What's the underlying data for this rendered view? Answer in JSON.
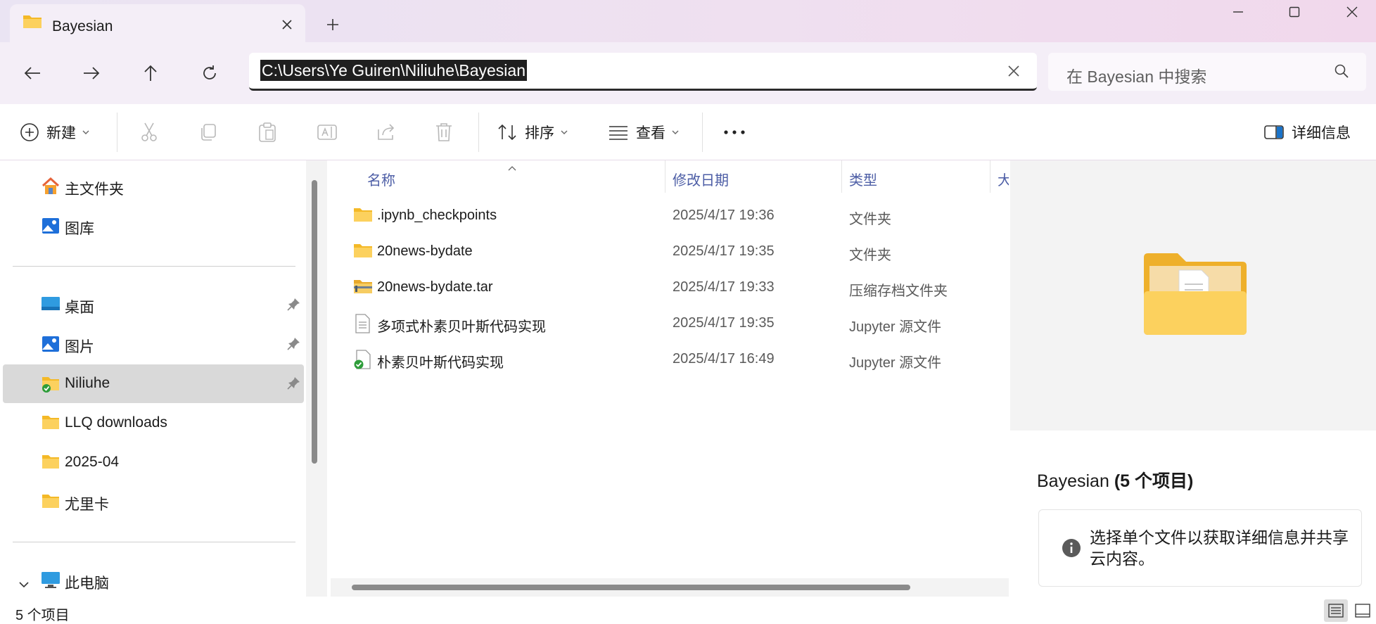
{
  "tab": {
    "title": "Bayesian",
    "new_tab": "+"
  },
  "address": {
    "path": "C:\\Users\\Ye Guiren\\Niliuhe\\Bayesian"
  },
  "search": {
    "placeholder": "在 Bayesian 中搜索"
  },
  "toolbar": {
    "new_label": "新建",
    "sort_label": "排序",
    "view_label": "查看",
    "more_label": "•••",
    "details_label": "详细信息"
  },
  "sidebar": {
    "home": "主文件夹",
    "gallery": "图库",
    "desktop": "桌面",
    "pictures": "图片",
    "niliuhe": "Niliuhe",
    "llq": "LLQ downloads",
    "month": "2025-04",
    "youlika": "尤里卡",
    "this_pc": "此电脑"
  },
  "columns": {
    "name": "名称",
    "modified": "修改日期",
    "type": "类型",
    "size": "大"
  },
  "files": [
    {
      "name": ".ipynb_checkpoints",
      "modified": "2025/4/17 19:36",
      "type": "文件夹",
      "icon": "folder-icon"
    },
    {
      "name": "20news-bydate",
      "modified": "2025/4/17 19:35",
      "type": "文件夹",
      "icon": "folder-icon"
    },
    {
      "name": "20news-bydate.tar",
      "modified": "2025/4/17 19:33",
      "type": "压缩存档文件夹",
      "icon": "zip-folder-icon"
    },
    {
      "name": "多项式朴素贝叶斯代码实现",
      "modified": "2025/4/17 19:35",
      "type": "Jupyter 源文件",
      "icon": "document-icon"
    },
    {
      "name": "朴素贝叶斯代码实现",
      "modified": "2025/4/17 16:49",
      "type": "Jupyter 源文件",
      "icon": "synced-document-icon"
    }
  ],
  "details": {
    "folder_name": "Bayesian",
    "count": "(5 个项目)",
    "info": "选择单个文件以获取详细信息并共享云内容。"
  },
  "status": {
    "items": "5 个项目"
  },
  "colors": {
    "accent": "#4d5ea6",
    "folder": "#f8c43d",
    "selected": "#d9d9d9"
  }
}
